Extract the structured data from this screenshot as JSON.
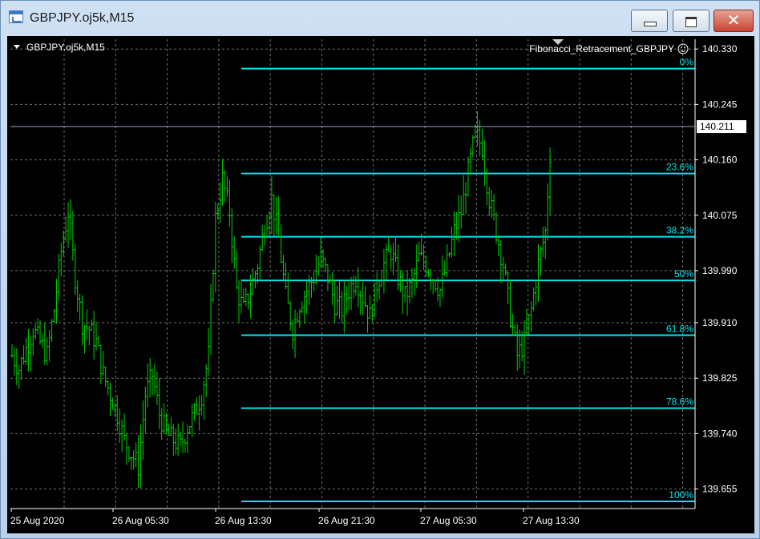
{
  "window": {
    "title": "GBPJPY.oj5k,M15",
    "buttons": {
      "minimize": "minimize",
      "maximize": "maximize",
      "close": "✕"
    }
  },
  "chart": {
    "symbol_label": "GBPJPY.oj5k,M15",
    "indicator_label": "Fibonacci_Retracement_GBPJPY",
    "current_price": "140.211",
    "colors": {
      "background": "#000000",
      "grid": "#6e6e6e",
      "candle": "#00d000",
      "fib_line": "#00e5ee",
      "fib_text": "#00e5ee",
      "axis_text": "#ffffff",
      "price_line": "#9aa9c0"
    },
    "price_ticks": [
      "140.330",
      "140.245",
      "140.160",
      "140.075",
      "139.990",
      "139.910",
      "139.825",
      "139.740",
      "139.655"
    ],
    "time_ticks": [
      "25 Aug 2020",
      "26 Aug 05:30",
      "26 Aug 13:30",
      "26 Aug 21:30",
      "27 Aug 05:30",
      "27 Aug 13:30"
    ],
    "fib_levels": [
      {
        "label": "0%",
        "price": 140.3
      },
      {
        "label": "23.6%",
        "price": 140.139
      },
      {
        "label": "38.2%",
        "price": 140.042
      },
      {
        "label": "50%",
        "price": 139.975
      },
      {
        "label": "61.8%",
        "price": 139.891
      },
      {
        "label": "78.6%",
        "price": 139.779
      },
      {
        "label": "100%",
        "price": 139.636
      }
    ]
  },
  "chart_data": {
    "type": "line",
    "title": "",
    "ylim": [
      139.625,
      140.345
    ],
    "grid": true,
    "x": [
      "25 Aug 2020",
      "26 Aug 05:30",
      "26 Aug 13:30",
      "26 Aug 21:30",
      "27 Aug 05:30",
      "27 Aug 13:30"
    ],
    "series": [
      {
        "values": [
          139.86,
          139.84,
          139.87,
          139.9,
          139.88,
          139.86,
          139.93,
          140.02,
          140.08,
          139.98,
          139.91,
          139.9,
          139.88,
          139.83,
          139.8,
          139.77,
          139.73,
          139.71,
          139.69,
          139.8,
          139.83,
          139.77,
          139.74,
          139.73,
          139.72,
          139.75,
          139.77,
          139.8,
          139.86,
          140.07,
          140.13,
          140.08,
          139.96,
          139.93,
          139.96,
          140.0,
          140.06,
          140.1,
          140.04,
          139.95,
          139.9,
          139.94,
          139.96,
          139.98,
          140.01,
          139.98,
          139.94,
          139.93,
          139.96,
          139.98,
          139.95,
          139.92,
          139.97,
          140.0,
          140.02,
          139.98,
          139.95,
          139.97,
          140.01,
          140.0,
          139.98,
          139.96,
          140.0,
          140.05,
          140.08,
          140.14,
          140.2,
          140.18,
          140.1,
          140.05,
          140.0,
          139.92,
          139.86,
          139.88,
          139.93,
          140.0,
          140.05,
          140.23
        ]
      }
    ]
  }
}
